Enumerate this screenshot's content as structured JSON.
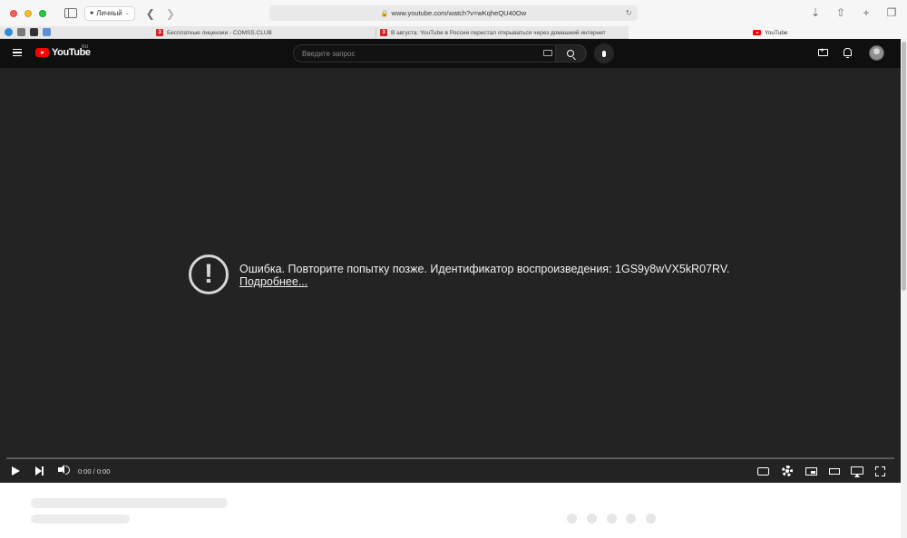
{
  "browser": {
    "profile_label": "Личный",
    "url": "www.youtube.com/watch?v=wKqheQU40Ow",
    "tabs": [
      {
        "title": "Бесплатные лицензии - COMSS.CLUB"
      },
      {
        "title": "В августа: YouTube в России перестал открываться через домашний интернет"
      },
      {
        "title": "YouTube"
      }
    ]
  },
  "youtube": {
    "logo_text": "YouTube",
    "region": "RU",
    "search_placeholder": "Введите запрос",
    "error_message": "Ошибка. Повторите попытку позже. Идентификатор воспроизведения: 1GS9y8wVX5kR07RV.",
    "error_link": "Подробнее...",
    "time_display": "0:00 / 0:00"
  },
  "colors": {
    "header_bg": "#0f0f0f",
    "player_bg": "#232323",
    "brand_red": "#ff0000"
  },
  "icons": [
    "sidebar-icon",
    "chevron-left-icon",
    "chevron-right-icon",
    "lock-icon",
    "reload-icon",
    "download-icon",
    "share-icon",
    "new-tab-icon",
    "tab-overview-icon",
    "menu-icon",
    "keyboard-icon",
    "search-icon",
    "mic-icon",
    "create-icon",
    "bell-icon",
    "error-icon",
    "play-icon",
    "next-icon",
    "volume-icon",
    "subtitles-icon",
    "settings-icon",
    "miniplayer-icon",
    "theater-icon",
    "airplay-icon",
    "fullscreen-icon"
  ]
}
